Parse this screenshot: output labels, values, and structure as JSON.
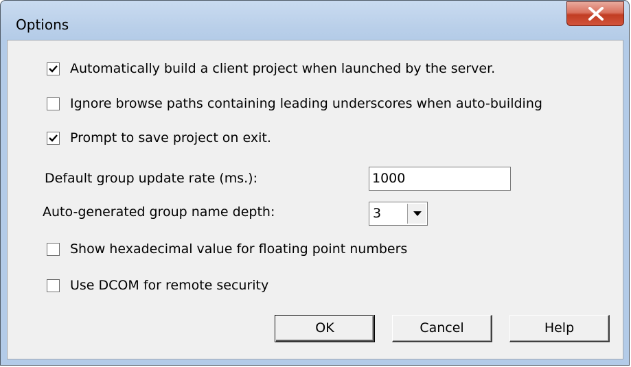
{
  "window": {
    "title": "Options"
  },
  "checkboxes": [
    {
      "label": "Automatically build a client project when launched by the server.",
      "checked": true
    },
    {
      "label": "Ignore browse paths containing leading underscores when auto-building",
      "checked": false
    },
    {
      "label": "Prompt to save project on exit.",
      "checked": true
    },
    {
      "label": "Show hexadecimal value for floating point numbers",
      "checked": false
    },
    {
      "label": "Use DCOM for remote security",
      "checked": false
    }
  ],
  "update_rate": {
    "label": "Default group update rate (ms.):",
    "value": "1000"
  },
  "name_depth": {
    "label": "Auto-generated group name depth:",
    "value": "3"
  },
  "buttons": {
    "ok": "OK",
    "cancel": "Cancel",
    "help": "Help"
  }
}
